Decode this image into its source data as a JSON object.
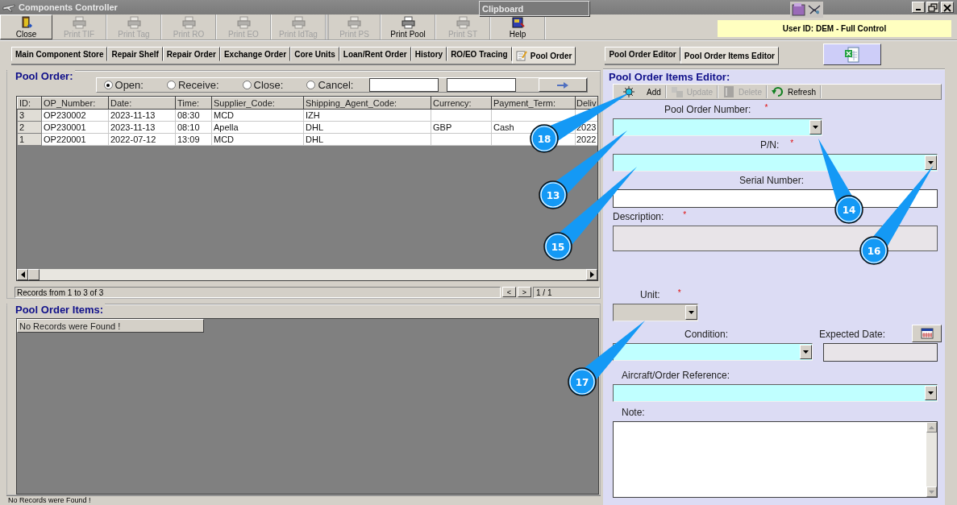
{
  "window": {
    "title": "Components Controller",
    "clipboard_label": "Clipboard"
  },
  "toolbar": [
    {
      "label": "Close",
      "kind": "door",
      "disabled": false
    },
    {
      "label": "Print TIF",
      "kind": "printer",
      "disabled": true
    },
    {
      "label": "Print Tag",
      "kind": "printer",
      "disabled": true
    },
    {
      "label": "Print RO",
      "kind": "printer",
      "disabled": true
    },
    {
      "label": "Print EO",
      "kind": "printer",
      "disabled": true
    },
    {
      "label": "Print IdTag",
      "kind": "printer",
      "disabled": true
    },
    {
      "label": "Print PS",
      "kind": "printer",
      "disabled": true
    },
    {
      "label": "Print Pool",
      "kind": "printer",
      "disabled": false
    },
    {
      "label": "Print ST",
      "kind": "printer",
      "disabled": true
    },
    {
      "label": "Help",
      "kind": "book",
      "disabled": false
    }
  ],
  "user_info": "User ID: DEM - Full Control",
  "tabs": [
    {
      "label": "Main Component Store",
      "selected": false
    },
    {
      "label": "Repair Shelf",
      "selected": false
    },
    {
      "label": "Repair Order",
      "selected": false
    },
    {
      "label": "Exchange Order",
      "selected": false
    },
    {
      "label": "Core Units",
      "selected": false
    },
    {
      "label": "Loan/Rent Order",
      "selected": false
    },
    {
      "label": "History",
      "selected": false
    },
    {
      "label": "RO/EO Tracing",
      "selected": false
    },
    {
      "label": "Pool Order",
      "selected": true
    }
  ],
  "editor_tabs": [
    {
      "label": "Pool Order Editor",
      "selected": false
    },
    {
      "label": "Pool Order Items Editor",
      "selected": true
    }
  ],
  "pool_order": {
    "title": "Pool Order:",
    "filters": [
      {
        "label": "Open:",
        "selected": true
      },
      {
        "label": "Receive:",
        "selected": false
      },
      {
        "label": "Close:",
        "selected": false
      },
      {
        "label": "Cancel:",
        "selected": false
      }
    ],
    "columns": [
      "ID:",
      "OP_Number:",
      "Date:",
      "Time:",
      "Supplier_Code:",
      "Shipping_Agent_Code:",
      "Currency:",
      "Payment_Term:",
      "Deliv"
    ],
    "rows": [
      [
        "3",
        "OP230002",
        "2023-11-13",
        "08:30",
        "MCD",
        "IZH",
        null,
        null,
        null
      ],
      [
        "2",
        "OP230001",
        "2023-11-13",
        "08:10",
        "Apella",
        "DHL",
        "GBP",
        "Cash",
        "2023"
      ],
      [
        "1",
        "OP220001",
        "2022-07-12",
        "13:09",
        "MCD",
        "DHL",
        null,
        null,
        "2022"
      ]
    ],
    "status": "Records from 1 to 3 of 3",
    "prev": "<",
    "next": ">",
    "page": "1 / 1"
  },
  "pool_order_items": {
    "title": "Pool Order Items:",
    "message": "No Records were Found !"
  },
  "status_bar": "No Records were Found !",
  "editor": {
    "title": "Pool Order Items Editor:",
    "actions": [
      {
        "label": "Add",
        "kind": "add",
        "disabled": false
      },
      {
        "label": "Update",
        "kind": "update",
        "disabled": true
      },
      {
        "label": "Delete",
        "kind": "delete",
        "disabled": true
      },
      {
        "label": "Refresh",
        "kind": "refresh",
        "disabled": false
      }
    ],
    "fields": [
      {
        "label": "Pool Order Number:",
        "required_mark": "*",
        "kind": "combo",
        "disabled": false
      },
      {
        "label": "P/N:",
        "required_mark": "*",
        "kind": "combo",
        "disabled": false
      },
      {
        "label": "Serial Number:",
        "kind": "text"
      },
      {
        "label": "Description:",
        "required_mark": "*",
        "kind": "readonly"
      },
      {
        "label": "Unit:",
        "required_mark": "*",
        "kind": "combo",
        "disabled": true
      },
      {
        "label": "Condition:",
        "kind": "combo",
        "disabled": false
      },
      {
        "label": "Expected Date:",
        "kind": "date"
      },
      {
        "label": "Aircraft/Order Reference:",
        "kind": "combo",
        "disabled": false
      },
      {
        "label": "Note:",
        "kind": "memo"
      }
    ]
  },
  "callouts": [
    {
      "label": "18"
    },
    {
      "label": "13"
    },
    {
      "label": "14"
    },
    {
      "label": "15"
    },
    {
      "label": "16"
    },
    {
      "label": "17"
    }
  ]
}
